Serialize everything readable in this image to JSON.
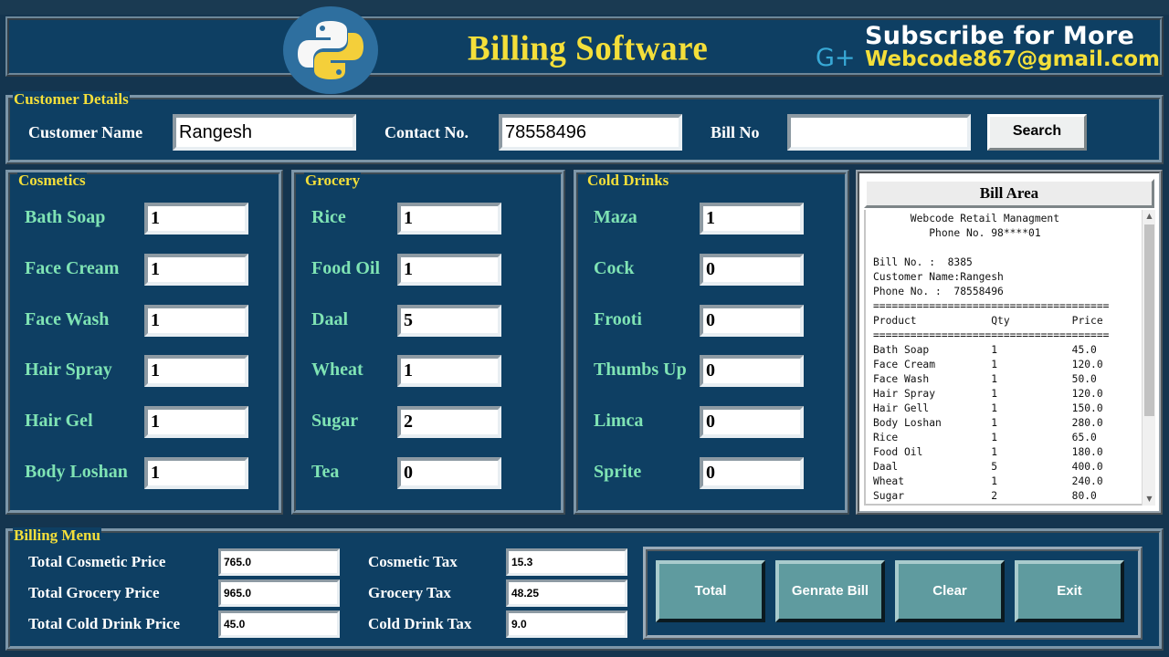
{
  "header": {
    "title": "Billing Software",
    "subscribe": "Subscribe for More",
    "gplus": "G+",
    "email": "Webcode867@gmail.com"
  },
  "customer": {
    "section_label": "Customer Details",
    "name_label": "Customer Name",
    "name_value": "Rangesh",
    "contact_label": "Contact No.",
    "contact_value": "78558496",
    "bill_label": "Bill No",
    "bill_value": "",
    "search_label": "Search"
  },
  "cosmetics": {
    "section_label": "Cosmetics",
    "items": [
      {
        "label": "Bath Soap",
        "qty": "1"
      },
      {
        "label": "Face Cream",
        "qty": "1"
      },
      {
        "label": "Face Wash",
        "qty": "1"
      },
      {
        "label": "Hair Spray",
        "qty": "1"
      },
      {
        "label": "Hair Gel",
        "qty": "1"
      },
      {
        "label": "Body Loshan",
        "qty": "1"
      }
    ]
  },
  "grocery": {
    "section_label": "Grocery",
    "items": [
      {
        "label": "Rice",
        "qty": "1"
      },
      {
        "label": "Food Oil",
        "qty": "1"
      },
      {
        "label": "Daal",
        "qty": "5"
      },
      {
        "label": "Wheat",
        "qty": "1"
      },
      {
        "label": "Sugar",
        "qty": "2"
      },
      {
        "label": "Tea",
        "qty": "0"
      }
    ]
  },
  "cold_drinks": {
    "section_label": "Cold Drinks",
    "items": [
      {
        "label": "Maza",
        "qty": "1"
      },
      {
        "label": "Cock",
        "qty": "0"
      },
      {
        "label": "Frooti",
        "qty": "0"
      },
      {
        "label": "Thumbs Up",
        "qty": "0"
      },
      {
        "label": "Limca",
        "qty": "0"
      },
      {
        "label": "Sprite",
        "qty": "0"
      }
    ]
  },
  "bill_area": {
    "title": "Bill Area",
    "lines": [
      "      Webcode Retail Managment",
      "         Phone No. 98****01",
      "",
      "Bill No. :  8385",
      "Customer Name:Rangesh",
      "Phone No. :  78558496",
      "======================================",
      "Product            Qty          Price",
      "======================================",
      "Bath Soap          1            45.0",
      "Face Cream         1            120.0",
      "Face Wash          1            50.0",
      "Hair Spray         1            120.0",
      "Hair Gell          1            150.0",
      "Body Loshan        1            280.0",
      "Rice               1            65.0",
      "Food Oil           1            180.0",
      "Daal               5            400.0",
      "Wheat              1            240.0",
      "Sugar              2            80.0"
    ]
  },
  "billing_menu": {
    "section_label": "Billing Menu",
    "total_cosmetic_label": "Total Cosmetic Price",
    "total_cosmetic_value": "765.0",
    "total_grocery_label": "Total Grocery Price",
    "total_grocery_value": "965.0",
    "total_cold_label": "Total Cold Drink Price",
    "total_cold_value": "45.0",
    "cosmetic_tax_label": "Cosmetic Tax",
    "cosmetic_tax_value": "15.3",
    "grocery_tax_label": "Grocery Tax",
    "grocery_tax_value": "48.25",
    "cold_tax_label": "Cold Drink Tax",
    "cold_tax_value": "9.0"
  },
  "actions": {
    "total": "Total",
    "generate": "Genrate Bill",
    "clear": "Clear",
    "exit": "Exit"
  },
  "colors": {
    "background": "#14354f",
    "panel": "#0e3f63",
    "title_yellow": "#f4df3a",
    "item_green": "#7fe3b4",
    "button_teal": "#5f9b9f"
  }
}
